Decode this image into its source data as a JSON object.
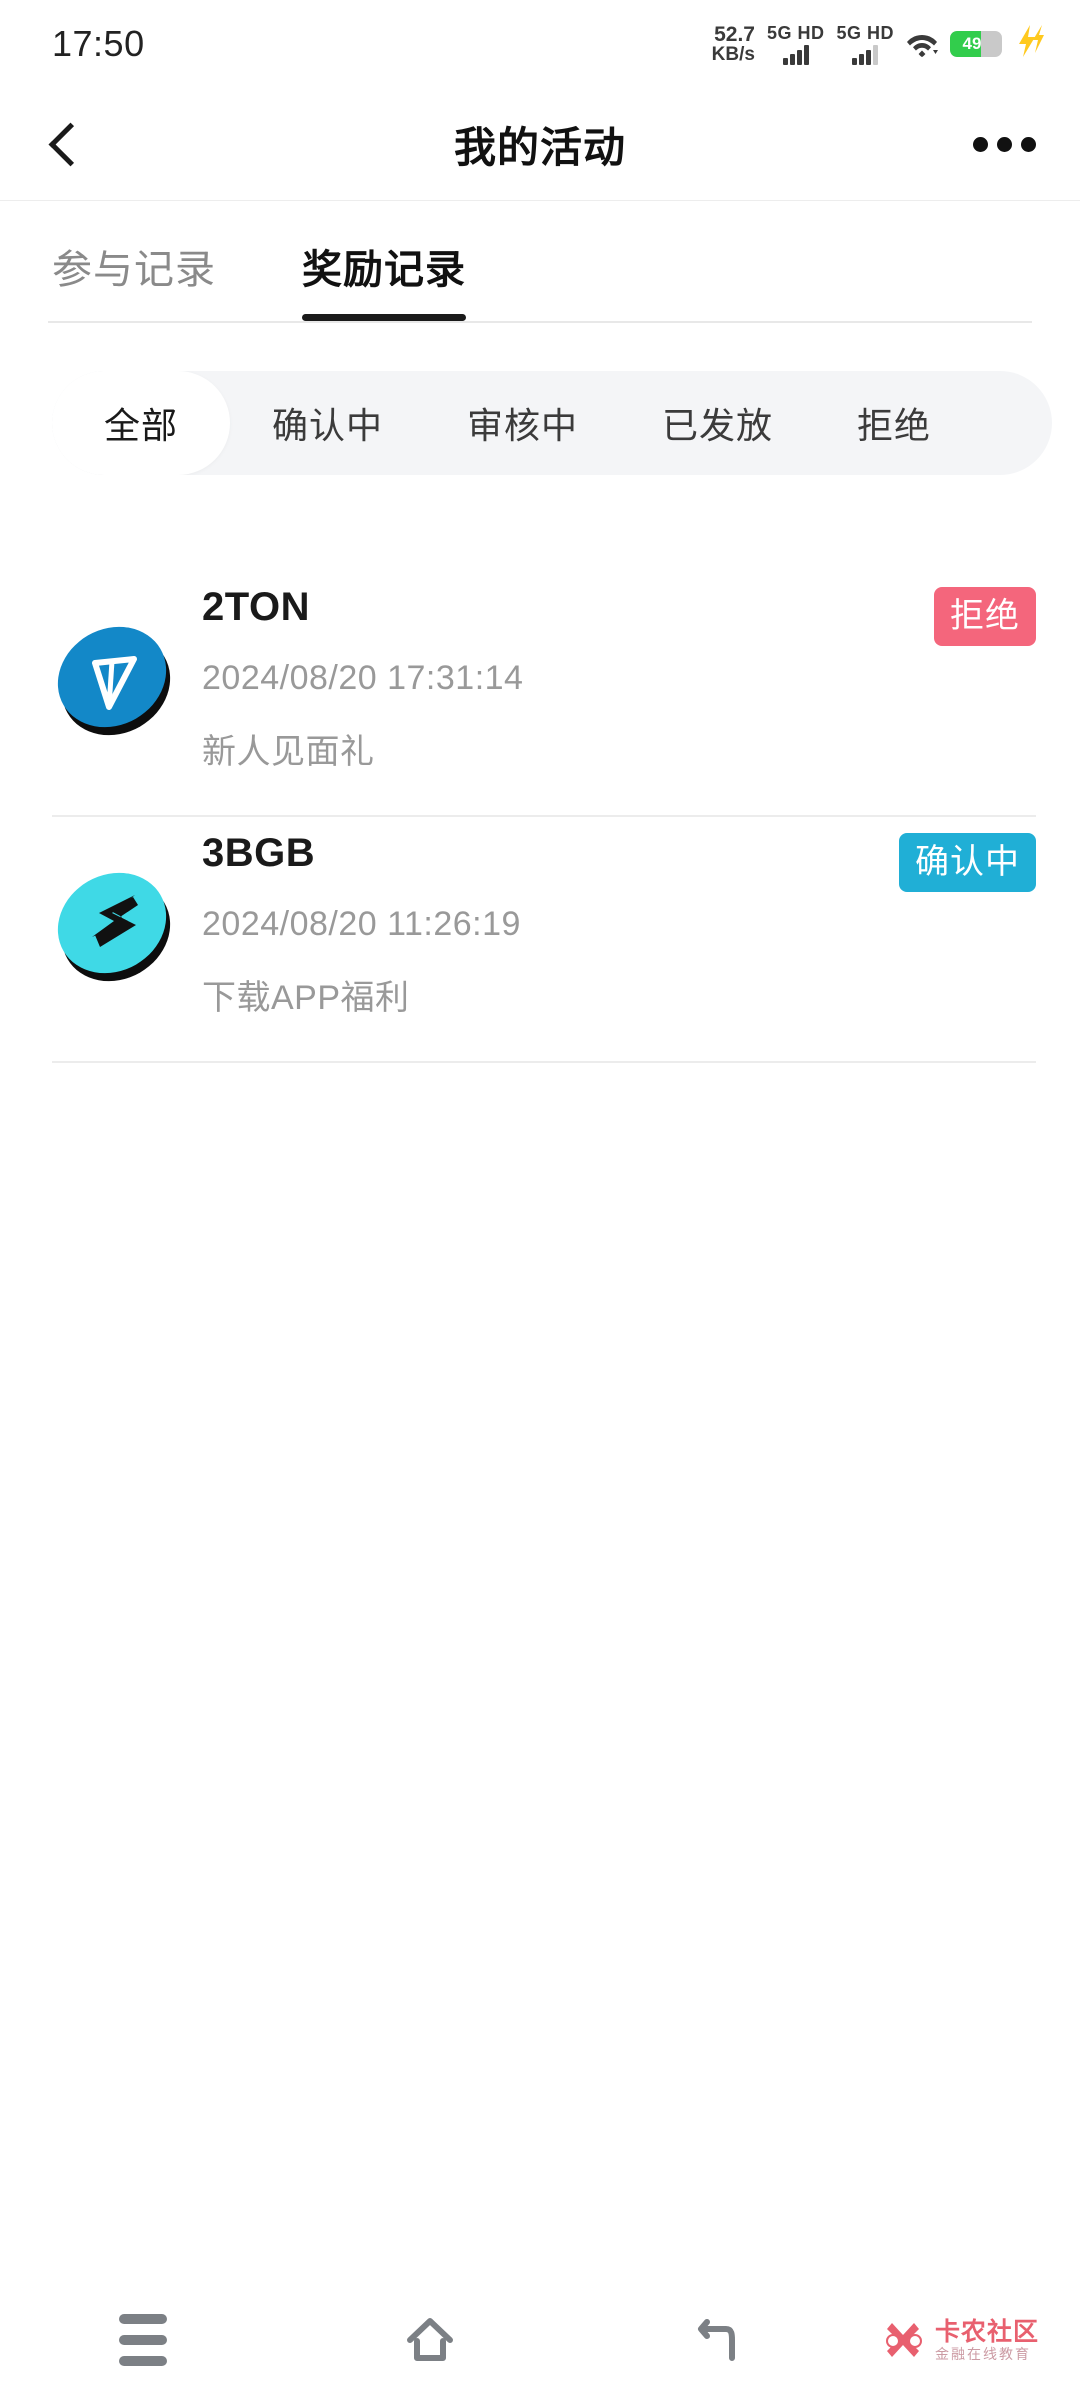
{
  "status_bar": {
    "time": "17:50",
    "net_speed_value": "52.7",
    "net_speed_unit": "KB/s",
    "sim1_label": "5G HD",
    "sim2_label": "5G HD",
    "wifi_icon": "wifi-icon",
    "battery_level": "49",
    "battery_color": "#32cd4c",
    "charging_icon": "lightning-bolt-icon"
  },
  "header": {
    "back_icon": "chevron-left-icon",
    "title": "我的活动",
    "more_icon": "more-horizontal-icon"
  },
  "tabs": [
    {
      "label": "参与记录",
      "active": false
    },
    {
      "label": "奖励记录",
      "active": true
    }
  ],
  "filters": [
    {
      "label": "全部",
      "active": true
    },
    {
      "label": "确认中",
      "active": false
    },
    {
      "label": "审核中",
      "active": false
    },
    {
      "label": "已发放",
      "active": false
    },
    {
      "label": "拒绝",
      "active": false
    }
  ],
  "rewards": [
    {
      "icon": "ton-coin-icon",
      "icon_color": "#1388c8",
      "amount": "2TON",
      "datetime": "2024/08/20 17:31:14",
      "description": "新人见面礼",
      "status": "拒绝",
      "status_color": "#f4667c"
    },
    {
      "icon": "bgb-coin-icon",
      "icon_color": "#3fd9e6",
      "amount": "3BGB",
      "datetime": "2024/08/20 11:26:19",
      "description": "下载APP福利",
      "status": "确认中",
      "status_color": "#20afd6"
    }
  ],
  "nav_bar": {
    "recents_icon": "menu-icon",
    "home_icon": "home-icon",
    "back_icon": "back-arrow-icon",
    "watermark_icon": "kanong-logo-icon",
    "watermark_title": "卡农社区",
    "watermark_subtitle": "金融在线教育"
  }
}
